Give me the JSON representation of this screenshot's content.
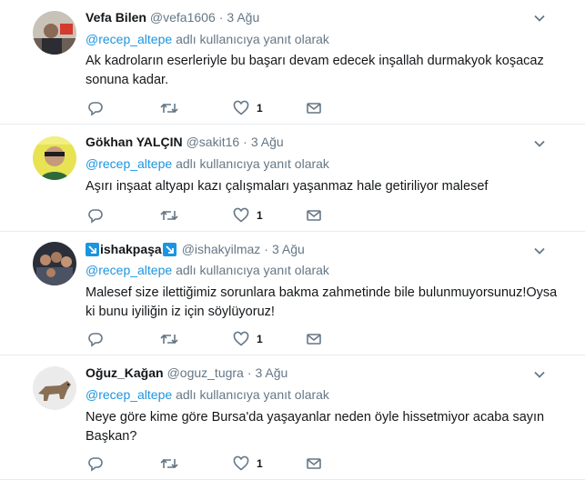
{
  "tweets": [
    {
      "display_name": "Vefa Bilen",
      "handle": "@vefa1606",
      "separator": "·",
      "time": "3 Ağu",
      "reply_mention": "@recep_altepe",
      "reply_suffix": "adlı kullanıcıya yanıt olarak",
      "text": "Ak kadroların eserleriyle bu başarı devam edecek inşallah durmakyok koşacaz sonuna kadar.",
      "like_count": "1",
      "avatar_icon": "person-avatar-icon"
    },
    {
      "display_name": "Gökhan YALÇIN",
      "handle": "@sakit16",
      "separator": "·",
      "time": "3 Ağu",
      "reply_mention": "@recep_altepe",
      "reply_suffix": "adlı kullanıcıya yanıt olarak",
      "text": "Aşırı inşaat altyapı kazı çalışmaları yaşanmaz hale getiriliyor malesef",
      "like_count": "1",
      "avatar_icon": "person-avatar-icon"
    },
    {
      "display_name": "ishakpaşa",
      "handle": "@ishakyilmaz",
      "separator": "·",
      "time": "3 Ağu",
      "reply_mention": "@recep_altepe",
      "reply_suffix": "adlı kullanıcıya yanıt olarak",
      "text": "Malesef size ilettiğimiz sorunlara bakma zahmetinde bile bulunmuyorsunuz!Oysa ki bunu iyiliğin iz için söylüyoruz!",
      "like_count": "1",
      "avatar_icon": "group-photo-avatar-icon"
    },
    {
      "display_name": "Oğuz_Kağan",
      "handle": "@oguz_tugra",
      "separator": "·",
      "time": "3 Ağu",
      "reply_mention": "@recep_altepe",
      "reply_suffix": "adlı kullanıcıya yanıt olarak",
      "text": "Neye göre kime göre Bursa'da yaşayanlar neden öyle hissetmiyor acaba sayın Başkan?",
      "like_count": "1",
      "avatar_icon": "wolf-avatar-icon"
    }
  ],
  "colors": {
    "link": "#1b95e0",
    "secondary_text": "#657786",
    "primary_text": "#14171a",
    "divider": "#e6ecf0"
  },
  "icons": [
    "reply-icon",
    "retweet-icon",
    "like-icon",
    "direct-message-icon",
    "chevron-down-icon",
    "arrow-badge-icon"
  ]
}
